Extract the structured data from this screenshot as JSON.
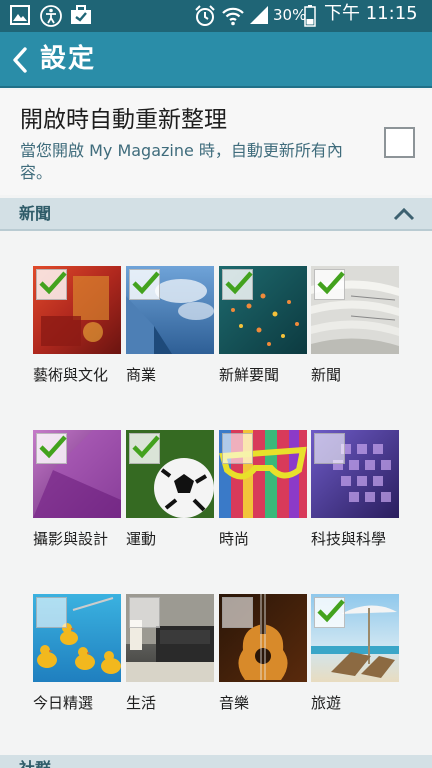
{
  "status_bar": {
    "battery": "30%",
    "time": "下午 11:15",
    "left_icons": [
      "gallery-icon",
      "accessibility-icon",
      "briefcase-check-icon"
    ],
    "right_icons": [
      "alarm-icon",
      "wifi-icon",
      "signal-icon",
      "battery-icon"
    ]
  },
  "action_bar": {
    "title": "設定"
  },
  "auto_refresh": {
    "title": "開啟時自動重新整理",
    "description": "當您開啟 My Magazine 時，自動更新所有內容。",
    "checked": false
  },
  "news_section": {
    "label": "新聞",
    "expanded": true,
    "tiles": [
      {
        "label": "藝術與文化",
        "checked": true
      },
      {
        "label": "商業",
        "checked": true
      },
      {
        "label": "新鮮要聞",
        "checked": true
      },
      {
        "label": "新聞",
        "checked": true
      },
      {
        "label": "攝影與設計",
        "checked": true
      },
      {
        "label": "運動",
        "checked": true
      },
      {
        "label": "時尚",
        "checked": false
      },
      {
        "label": "科技與科學",
        "checked": false
      },
      {
        "label": "今日精選",
        "checked": false
      },
      {
        "label": "生活",
        "checked": false
      },
      {
        "label": "音樂",
        "checked": false
      },
      {
        "label": "旅遊",
        "checked": true
      }
    ]
  },
  "social_section": {
    "label": "社群"
  },
  "colors": {
    "status_bar": "#1f6576",
    "action_bar": "#2a8da8",
    "section_header": "#d3e0e5",
    "check_green": "#43a21e"
  }
}
